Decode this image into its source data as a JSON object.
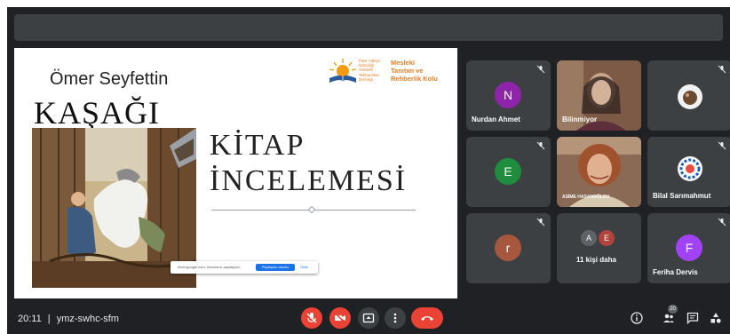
{
  "meeting": {
    "time": "20:11",
    "separator": "|",
    "code": "ymz-swhc-sfm"
  },
  "slide": {
    "author": "Ömer Seyfettin",
    "book_title": "KAŞAĞI",
    "heading_line1": "KİTAP",
    "heading_line2": "İNCELEMESİ",
    "logo": {
      "small_text": "Patır Yükiye İştiriçiliği Yükselti Tahbanlıları Derneği",
      "title_lines": [
        "Mesleki",
        "Tanıtım ve",
        "Rehberlik Kolu"
      ]
    },
    "share_bar": {
      "text": "meet.google.com, ekranınızı paylaşıyor.",
      "stop_label": "Paylaşımı durdur",
      "hide_label": "Gizle"
    }
  },
  "participants": [
    {
      "name": "Nurdan Ahmet",
      "initial": "N",
      "avatar_color": "#8e24aa",
      "muted": true
    },
    {
      "name": "Bilinmiyor",
      "muted": false
    },
    {
      "name": "",
      "muted": true
    },
    {
      "name": "",
      "initial": "E",
      "avatar_color": "#1e8e3e",
      "muted": true
    },
    {
      "name": "ASİME HASANOĞLOU",
      "muted": false
    },
    {
      "name": "Bilal Sarımahmut",
      "muted": true
    },
    {
      "name": "",
      "initial": "r",
      "avatar_color": "#a5583d",
      "muted": true
    },
    {
      "name": "11 kişi daha",
      "initials": [
        "A",
        "E"
      ],
      "avatar_colors": [
        "#5f6368",
        "#b0433e"
      ],
      "muted": false
    },
    {
      "name": "Feriha Dervis",
      "initial": "F",
      "avatar_color": "#a142f4",
      "muted": true
    }
  ],
  "controls": {
    "participants_count": "20",
    "icons": [
      "mic-off-icon",
      "camera-off-icon",
      "present-icon",
      "more-vert-icon",
      "call-end-icon",
      "info-icon",
      "people-icon",
      "chat-icon",
      "activities-icon"
    ],
    "colors": {
      "danger": "#ea4335",
      "dark": "#3c4043",
      "accent": "#e67e22"
    }
  }
}
